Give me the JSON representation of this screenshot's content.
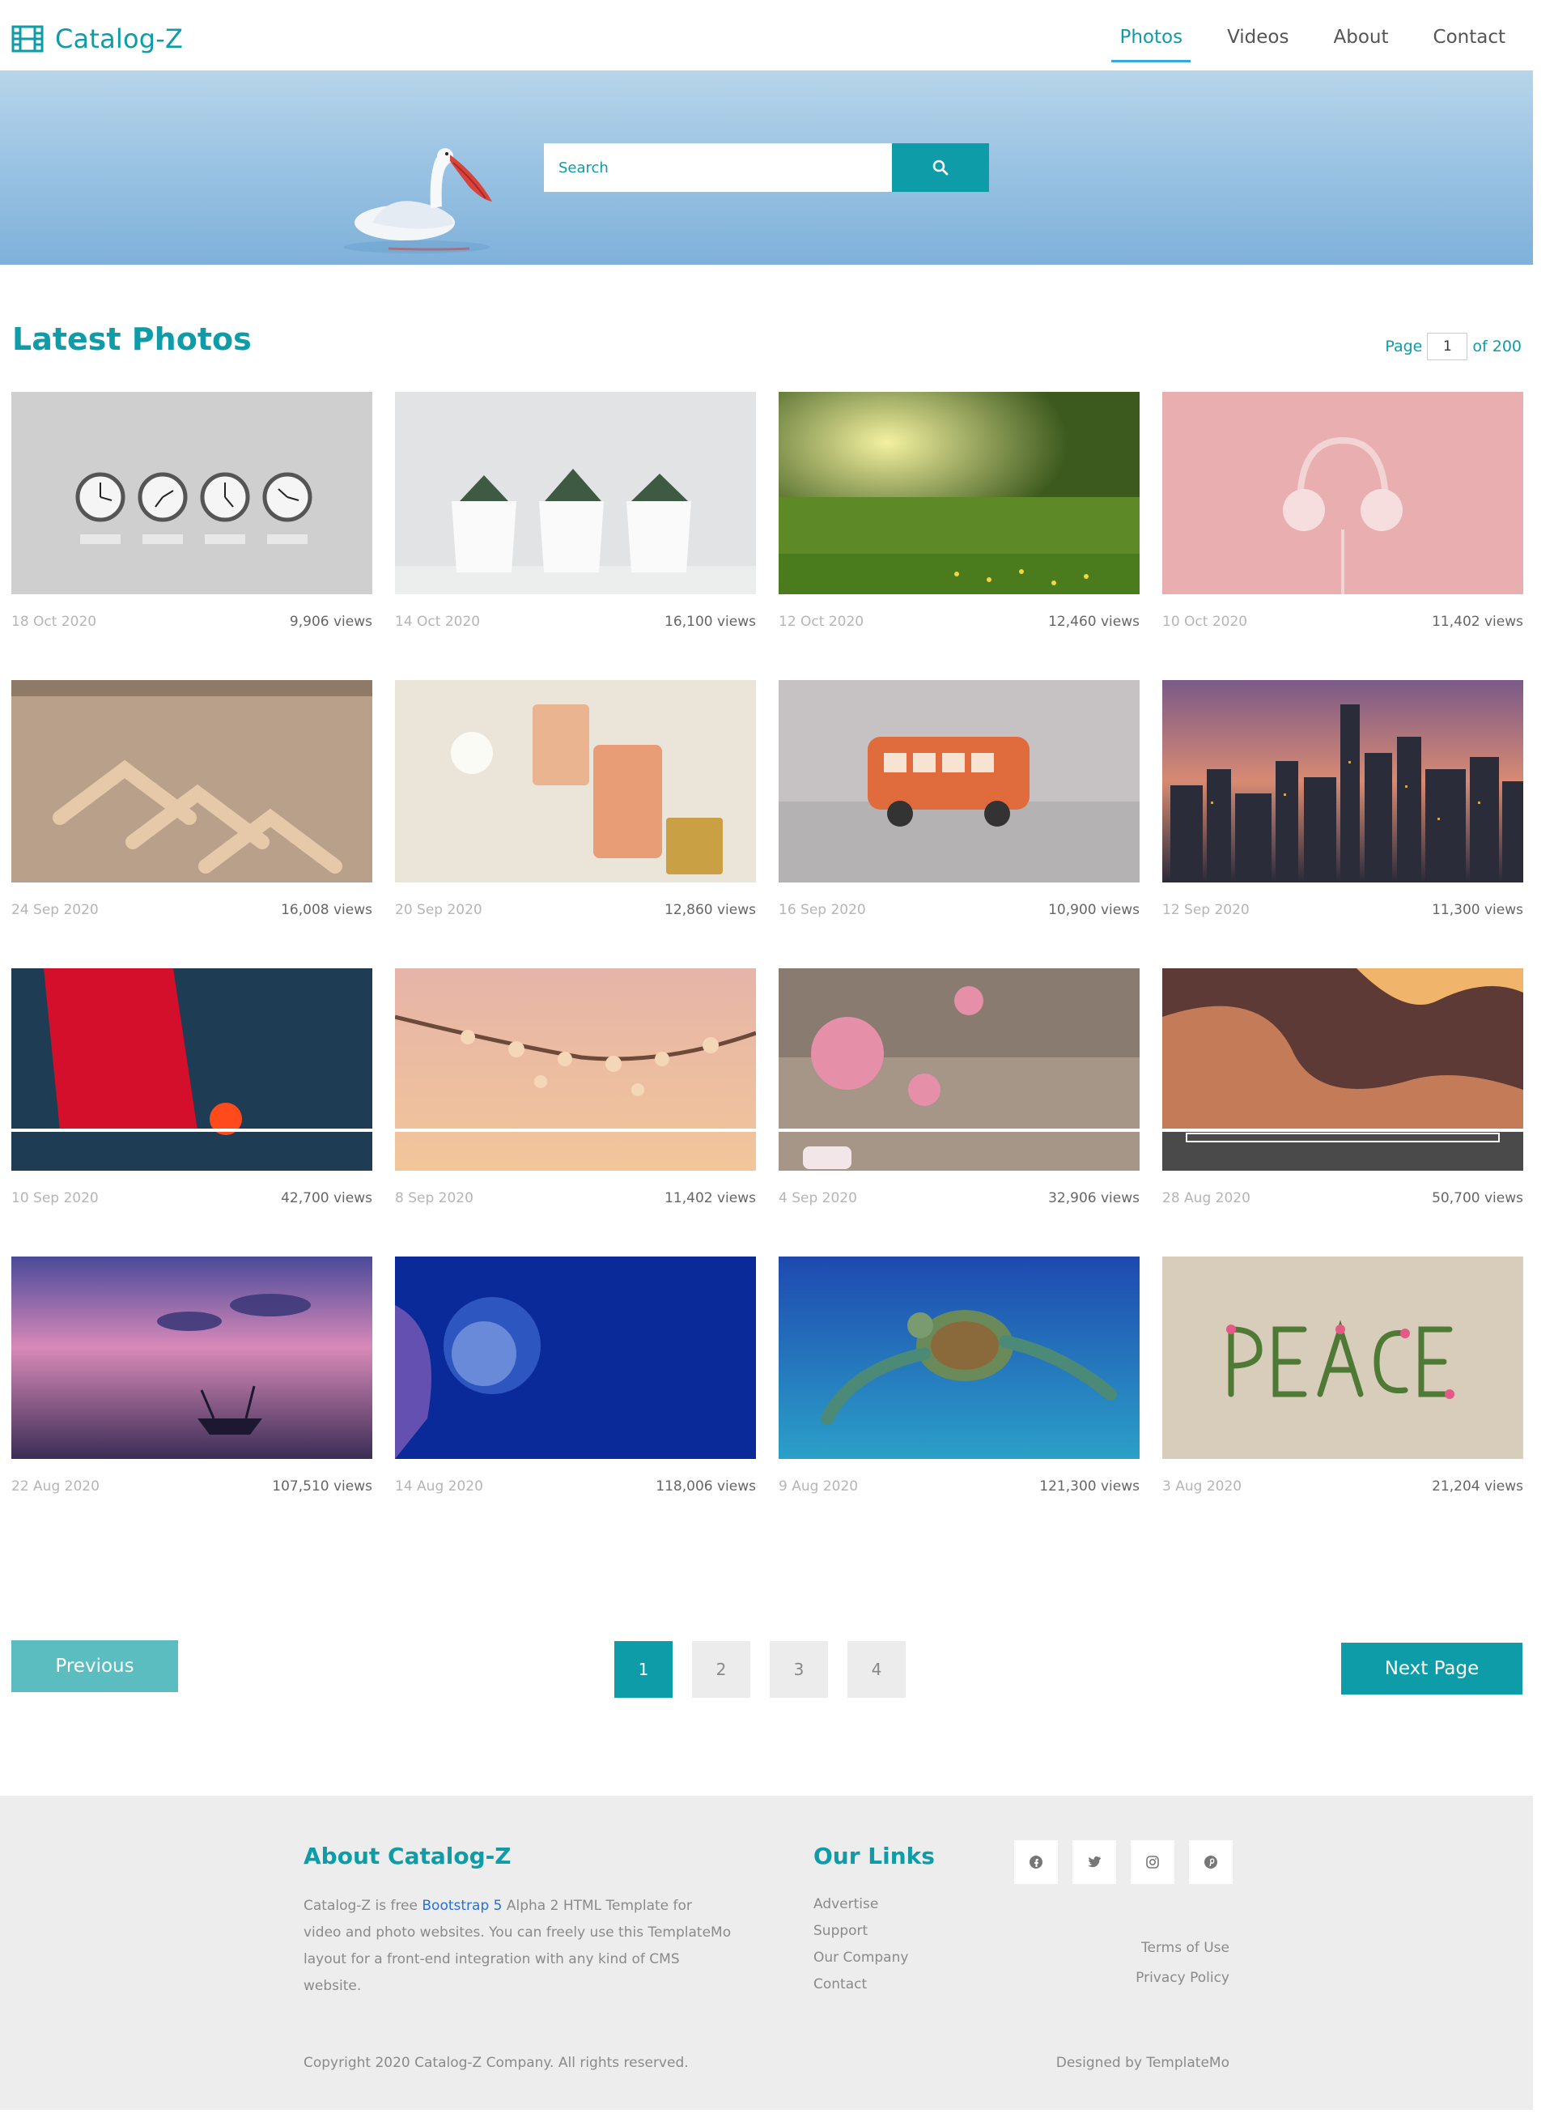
{
  "brand": {
    "name": "Catalog-Z",
    "icon": "film-icon"
  },
  "nav": {
    "items": [
      {
        "label": "Photos",
        "active": true
      },
      {
        "label": "Videos",
        "active": false
      },
      {
        "label": "About",
        "active": false
      },
      {
        "label": "Contact",
        "active": false
      }
    ]
  },
  "hero": {
    "search_placeholder": "Search",
    "search_icon": "search-icon"
  },
  "section": {
    "title": "Latest Photos",
    "page_label": "Page",
    "page_value": "1",
    "page_total": "of 200"
  },
  "photos": [
    {
      "date": "18 Oct 2020",
      "views": "9,906 views",
      "subject": "world clocks"
    },
    {
      "date": "14 Oct 2020",
      "views": "16,100 views",
      "subject": "succulent pots"
    },
    {
      "date": "12 Oct 2020",
      "views": "12,460 views",
      "subject": "sunlit meadow"
    },
    {
      "date": "10 Oct 2020",
      "views": "11,402 views",
      "subject": "pink headphones"
    },
    {
      "date": "24 Sep 2020",
      "views": "16,008 views",
      "subject": "wooden hangers"
    },
    {
      "date": "20 Sep 2020",
      "views": "12,860 views",
      "subject": "perfume bottles"
    },
    {
      "date": "16 Sep 2020",
      "views": "10,900 views",
      "subject": "toy bus"
    },
    {
      "date": "12 Sep 2020",
      "views": "11,300 views",
      "subject": "city skyline dusk"
    },
    {
      "date": "10 Sep 2020",
      "views": "42,700 views",
      "subject": "red abstract paint"
    },
    {
      "date": "8 Sep 2020",
      "views": "11,402 views",
      "subject": "blossom branch"
    },
    {
      "date": "4 Sep 2020",
      "views": "32,906 views",
      "subject": "pink roses"
    },
    {
      "date": "28 Aug 2020",
      "views": "50,700 views",
      "subject": "canyon waves"
    },
    {
      "date": "22 Aug 2020",
      "views": "107,510 views",
      "subject": "boat sunset"
    },
    {
      "date": "14 Aug 2020",
      "views": "118,006 views",
      "subject": "sea anemone"
    },
    {
      "date": "9 Aug 2020",
      "views": "121,300 views",
      "subject": "sea turtle"
    },
    {
      "date": "3 Aug 2020",
      "views": "21,204 views",
      "subject": "peace flowers"
    }
  ],
  "pagination": {
    "previous": "Previous",
    "next": "Next Page",
    "pages": [
      "1",
      "2",
      "3",
      "4"
    ],
    "active_page": "1"
  },
  "footer": {
    "about_title": "About Catalog-Z",
    "about_text_1": "Catalog-Z is free ",
    "about_link": "Bootstrap 5",
    "about_text_2": " Alpha 2 HTML Template for video and photo websites. You can freely use this TemplateMo layout for a front-end integration with any kind of CMS website.",
    "links_title": "Our Links",
    "links": [
      "Advertise",
      "Support",
      "Our Company",
      "Contact"
    ],
    "socials": [
      "facebook-icon",
      "twitter-icon",
      "instagram-icon",
      "pinterest-icon"
    ],
    "policy": [
      "Terms of Use",
      "Privacy Policy"
    ],
    "copyright": "Copyright 2020 Catalog-Z Company. All rights reserved.",
    "designed_by": "Designed by TemplateMo"
  },
  "colors": {
    "accent": "#0d9ca8",
    "prev_button": "#5bbdc0",
    "footer_bg": "#ededed"
  }
}
